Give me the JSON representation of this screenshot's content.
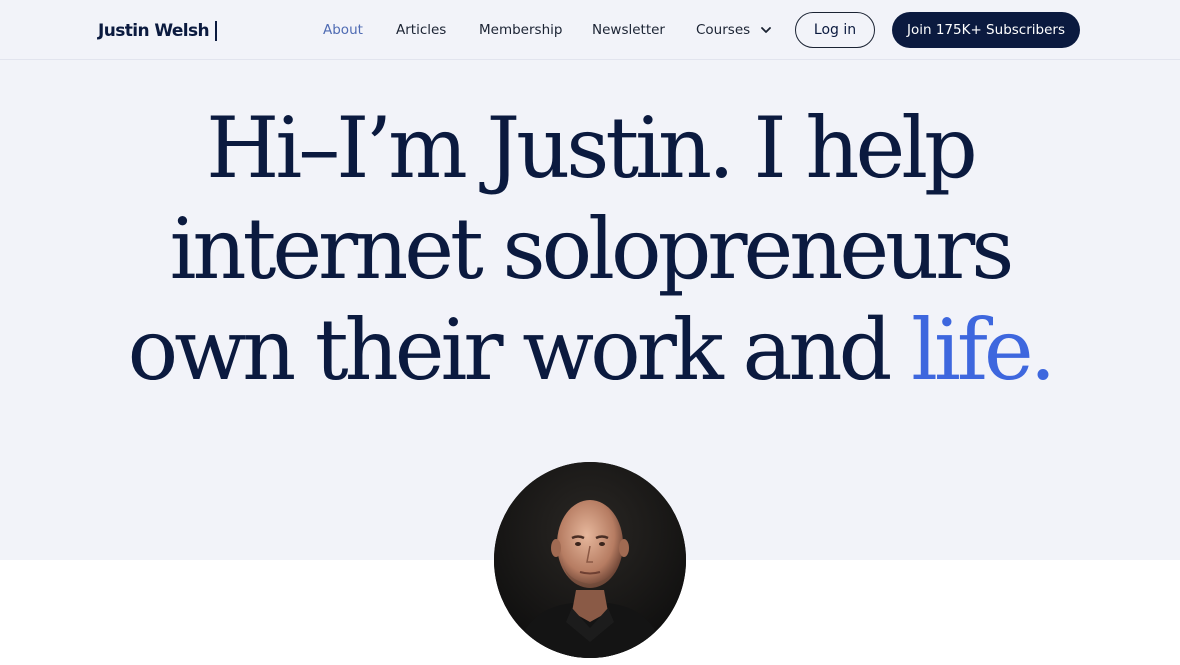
{
  "header": {
    "logo": "Justin Welsh",
    "nav": [
      {
        "label": "About",
        "active": true
      },
      {
        "label": "Articles",
        "active": false
      },
      {
        "label": "Membership",
        "active": false
      },
      {
        "label": "Newsletter",
        "active": false
      },
      {
        "label": "Courses",
        "active": false,
        "icon": "chevron-down-icon"
      }
    ],
    "login_label": "Log in",
    "join_label": "Join 175K+ Subscribers"
  },
  "hero": {
    "line1": "Hi–I’m Justin. I help",
    "line2": "internet solopreneurs",
    "line3_main": "own their work and ",
    "line3_accent": "life."
  },
  "colors": {
    "navy": "#0b1a3f",
    "accent_blue": "#3e67de",
    "hero_bg": "#f2f3f9",
    "active_nav": "#4f6bb3"
  }
}
